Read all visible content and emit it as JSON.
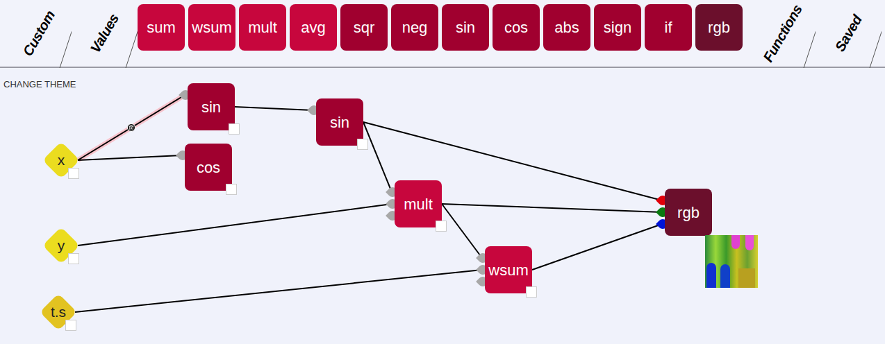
{
  "toolbar": {
    "left_tabs": [
      "Custom",
      "Values"
    ],
    "functions": [
      {
        "label": "sum",
        "color": "#c7063d"
      },
      {
        "label": "wsum",
        "color": "#c7063d"
      },
      {
        "label": "mult",
        "color": "#c7063d"
      },
      {
        "label": "avg",
        "color": "#c7063d"
      },
      {
        "label": "sqr",
        "color": "#a0002f"
      },
      {
        "label": "neg",
        "color": "#a0002f"
      },
      {
        "label": "sin",
        "color": "#a0002f"
      },
      {
        "label": "cos",
        "color": "#a0002f"
      },
      {
        "label": "abs",
        "color": "#a0002f"
      },
      {
        "label": "sign",
        "color": "#a0002f"
      },
      {
        "label": "if",
        "color": "#a0002f"
      },
      {
        "label": "rgb",
        "color": "#6b0f2c"
      }
    ],
    "right_tabs": [
      "Functions",
      "Saved"
    ]
  },
  "canvas": {
    "theme_button": "CHANGE THEME",
    "nodes": [
      {
        "label": "x",
        "kind": "input",
        "inputs": 0,
        "color": "#ebdc1f"
      },
      {
        "label": "y",
        "kind": "input",
        "inputs": 0,
        "color": "#ebdc1f"
      },
      {
        "label": "t.s",
        "kind": "input",
        "inputs": 0,
        "color": "#e2c321"
      },
      {
        "label": "sin",
        "kind": "function",
        "inputs": 1,
        "color": "#a0002f"
      },
      {
        "label": "cos",
        "kind": "function",
        "inputs": 1,
        "color": "#a0002f"
      },
      {
        "label": "sin",
        "kind": "function",
        "inputs": 1,
        "color": "#a0002f"
      },
      {
        "label": "mult",
        "kind": "function",
        "inputs": 3,
        "color": "#c7063d"
      },
      {
        "label": "wsum",
        "kind": "function",
        "inputs": 3,
        "color": "#c7063d"
      },
      {
        "label": "rgb",
        "kind": "output",
        "inputs": 3,
        "color": "#6b0f2c"
      }
    ],
    "edges": [
      {
        "from": 0,
        "to": 3,
        "port": 0,
        "highlighted": true
      },
      {
        "from": 0,
        "to": 4,
        "port": 0,
        "highlighted": false
      },
      {
        "from": 3,
        "to": 5,
        "port": 0,
        "highlighted": false
      },
      {
        "from": 5,
        "to": 8,
        "port": 0,
        "highlighted": false
      },
      {
        "from": 5,
        "to": 6,
        "port": 0,
        "highlighted": false
      },
      {
        "from": 1,
        "to": 6,
        "port": 1,
        "highlighted": false
      },
      {
        "from": 6,
        "to": 8,
        "port": 1,
        "highlighted": false
      },
      {
        "from": 6,
        "to": 7,
        "port": 0,
        "highlighted": false
      },
      {
        "from": 2,
        "to": 7,
        "port": 1,
        "highlighted": false
      },
      {
        "from": 7,
        "to": 8,
        "port": 2,
        "highlighted": false
      }
    ]
  }
}
